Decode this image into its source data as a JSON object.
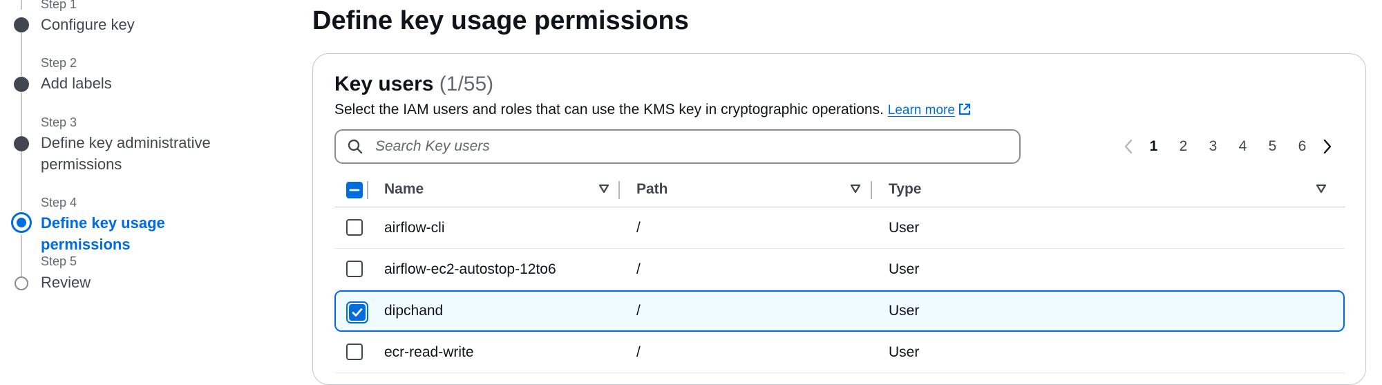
{
  "wizard": {
    "steps": [
      {
        "number": "Step 1",
        "title": "Configure key",
        "state": "done"
      },
      {
        "number": "Step 2",
        "title": "Add labels",
        "state": "done"
      },
      {
        "number": "Step 3",
        "title": "Define key administrative permissions",
        "state": "done"
      },
      {
        "number": "Step 4",
        "title": "Define key usage permissions",
        "state": "current"
      },
      {
        "number": "Step 5",
        "title": "Review",
        "state": "pending"
      }
    ]
  },
  "page": {
    "title": "Define key usage permissions"
  },
  "key_users": {
    "heading": "Key users",
    "count": "(1/55)",
    "description": "Select the IAM users and roles that can use the KMS key in cryptographic operations.",
    "learn_more": "Learn more",
    "search": {
      "placeholder": "Search Key users",
      "value": ""
    },
    "pagination": {
      "pages": [
        "1",
        "2",
        "3",
        "4",
        "5",
        "6"
      ],
      "current": "1"
    },
    "table": {
      "columns": [
        "Name",
        "Path",
        "Type"
      ],
      "rows": [
        {
          "name": "airflow-cli",
          "path": "/",
          "type": "User",
          "selected": false
        },
        {
          "name": "airflow-ec2-autostop-12to6",
          "path": "/",
          "type": "User",
          "selected": false
        },
        {
          "name": "dipchand",
          "path": "/",
          "type": "User",
          "selected": true
        },
        {
          "name": "ecr-read-write",
          "path": "/",
          "type": "User",
          "selected": false
        }
      ]
    }
  },
  "colors": {
    "accent": "#006ce0",
    "text": "#0f141a",
    "muted": "#656871",
    "selected_row_bg": "#f0fbff"
  },
  "icons": {
    "search": "search-icon",
    "external_link": "external-link-icon",
    "sort": "caret-down-outline-icon",
    "prev": "chevron-left-icon",
    "next": "chevron-right-icon"
  }
}
